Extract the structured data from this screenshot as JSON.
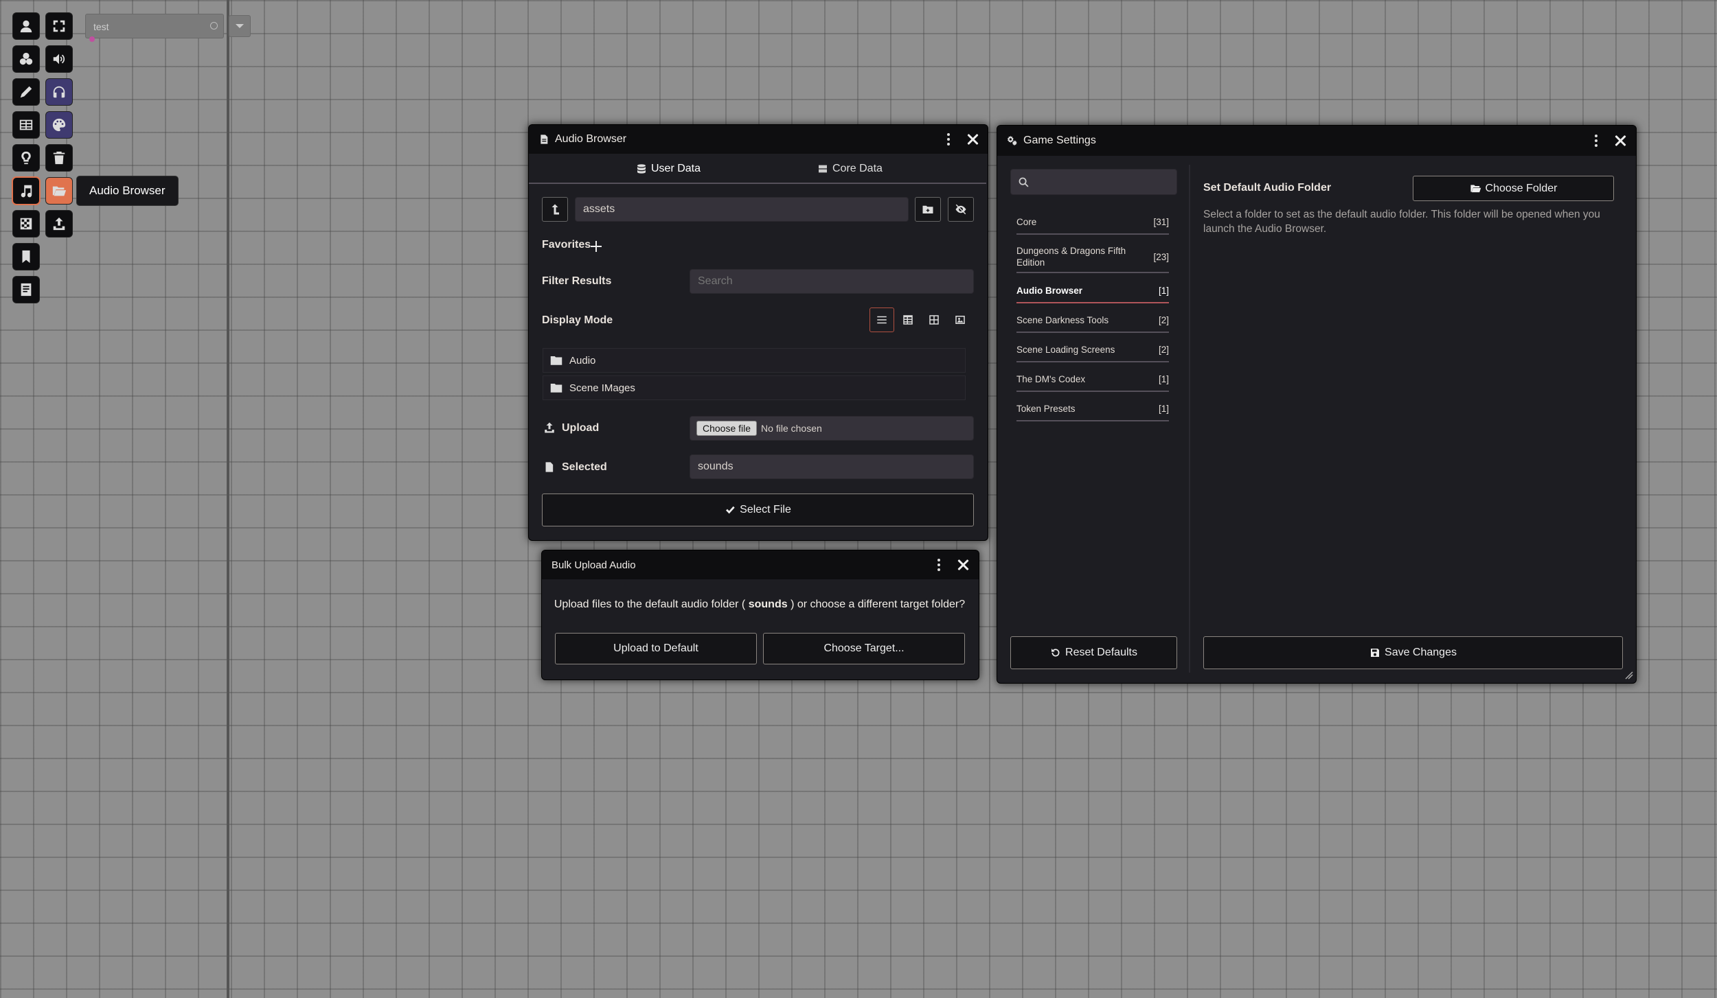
{
  "scene": {
    "name": "test"
  },
  "toolbar": {
    "tooltip": "Audio Browser"
  },
  "audio_browser": {
    "title": "Audio Browser",
    "tabs": [
      "User Data",
      "Core Data"
    ],
    "path": "assets",
    "favorites_label": "Favorites",
    "filter_label": "Filter Results",
    "filter_placeholder": "Search",
    "display_mode_label": "Display Mode",
    "folders": [
      "Audio",
      "Scene IMages"
    ],
    "upload_label": "Upload",
    "choose_file_btn": "Choose file",
    "no_file": "No file chosen",
    "selected_label": "Selected",
    "selected_value": "sounds",
    "select_file_btn": "Select File"
  },
  "bulk_upload": {
    "title": "Bulk Upload Audio",
    "message_pre": "Upload files to the default audio folder (",
    "message_bold": "sounds",
    "message_post": ") or choose a different target folder?",
    "upload_default_btn": "Upload to Default",
    "choose_target_btn": "Choose Target..."
  },
  "game_settings": {
    "title": "Game Settings",
    "categories": [
      {
        "name": "Core",
        "count": "[31]"
      },
      {
        "name": "Dungeons & Dragons Fifth Edition",
        "count": "[23]"
      },
      {
        "name": "Audio Browser",
        "count": "[1]"
      },
      {
        "name": "Scene Darkness Tools",
        "count": "[2]"
      },
      {
        "name": "Scene Loading Screens",
        "count": "[2]"
      },
      {
        "name": "The DM's Codex",
        "count": "[1]"
      },
      {
        "name": "Token Presets",
        "count": "[1]"
      }
    ],
    "setting_title": "Set Default Audio Folder",
    "choose_folder_btn": "Choose Folder",
    "setting_desc": "Select a folder to set as the default audio folder. This folder will be opened when you launch the Audio Browser.",
    "reset_btn": "Reset Defaults",
    "save_btn": "Save Changes"
  }
}
